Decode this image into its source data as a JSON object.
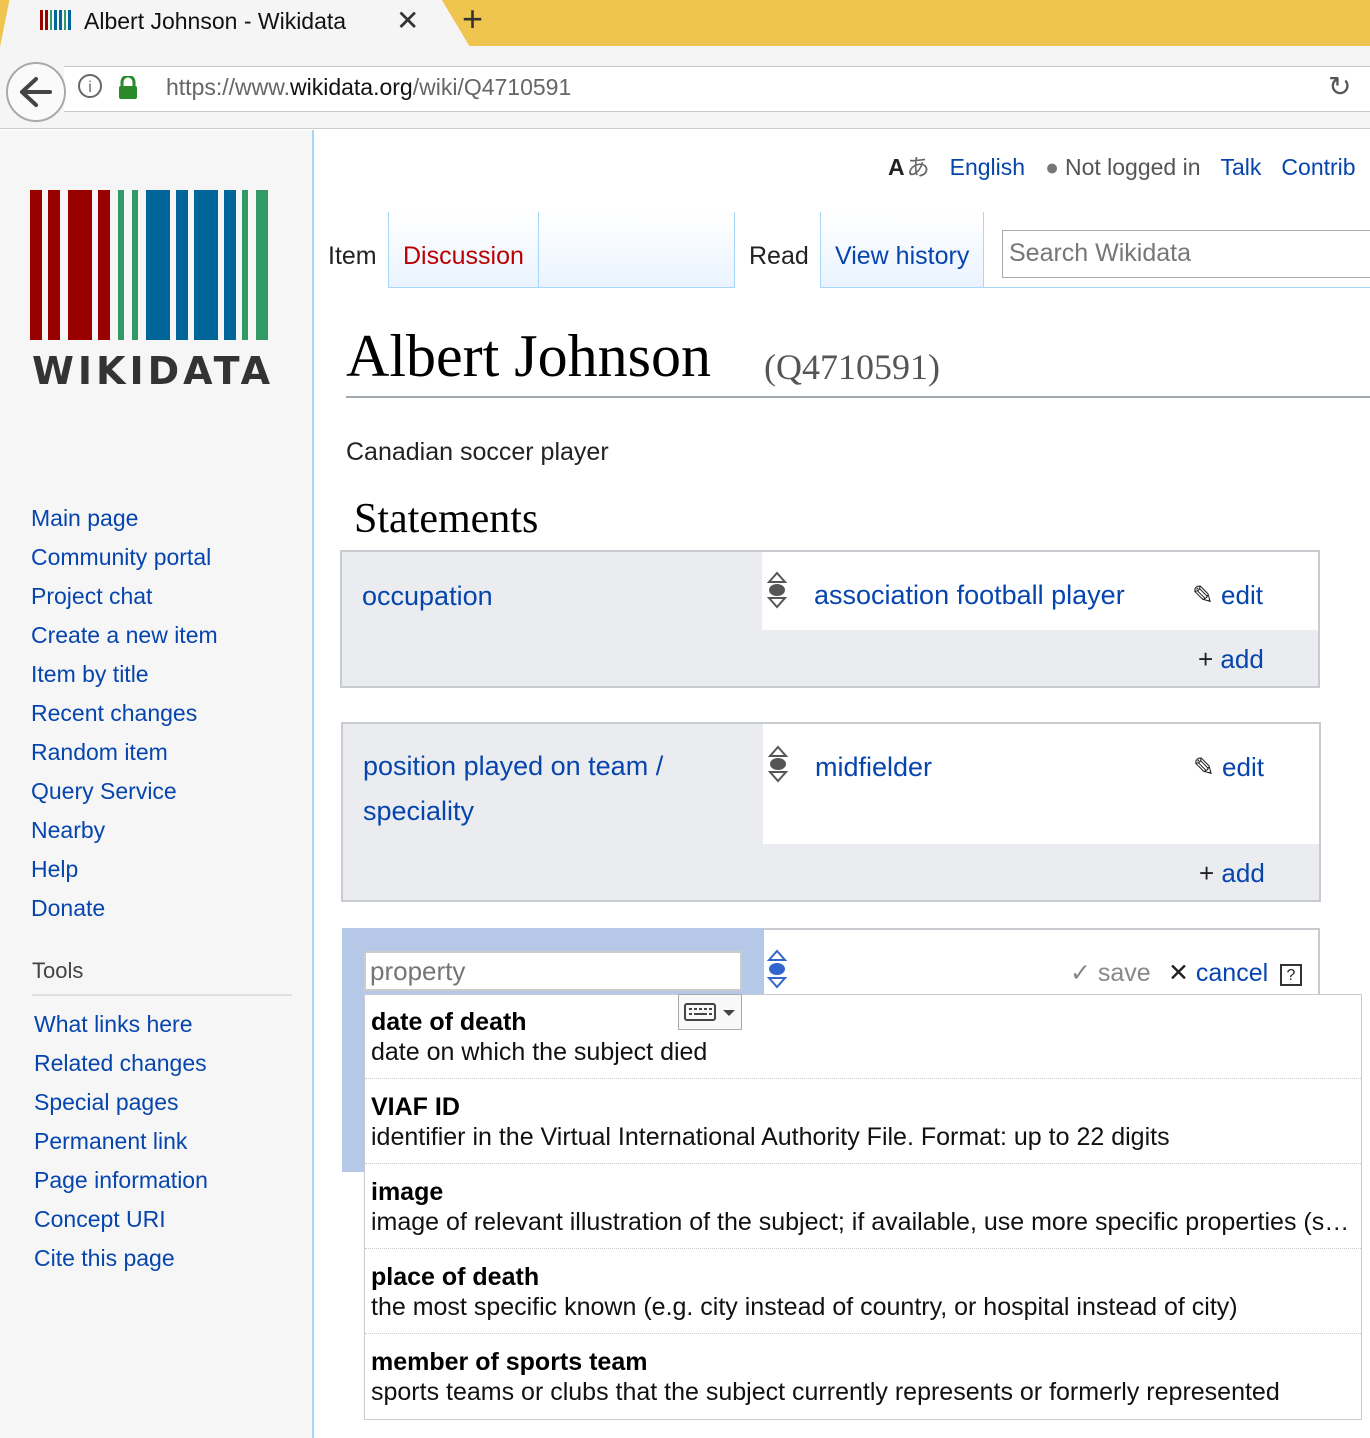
{
  "browser": {
    "tab_title": "Albert Johnson - Wikidata",
    "url_scheme": "https://www.",
    "url_host": "wikidata.org",
    "url_path": "/wiki/Q4710591"
  },
  "personal": {
    "language": "English",
    "not_logged_in": "Not logged in",
    "talk": "Talk",
    "contrib": "Contrib"
  },
  "tabs": {
    "item": "Item",
    "discussion": "Discussion",
    "read": "Read",
    "view_history": "View history"
  },
  "search": {
    "placeholder": "Search Wikidata"
  },
  "logo_text": "WIKIDATA",
  "sidebar": {
    "nav": [
      "Main page",
      "Community portal",
      "Project chat",
      "Create a new item",
      "Item by title",
      "Recent changes",
      "Random item",
      "Query Service",
      "Nearby",
      "Help",
      "Donate"
    ],
    "tools_heading": "Tools",
    "tools": [
      "What links here",
      "Related changes",
      "Special pages",
      "Permanent link",
      "Page information",
      "Concept URI",
      "Cite this page"
    ]
  },
  "page": {
    "title": "Albert Johnson",
    "qid": "(Q4710591)",
    "description": "Canadian soccer player",
    "statements_heading": "Statements"
  },
  "statements": [
    {
      "property": "occupation",
      "value": "association football player",
      "edit": "edit",
      "add": "add"
    },
    {
      "property_line1": "position played on team /",
      "property_line2": "speciality",
      "value": "midfielder",
      "edit": "edit",
      "add": "add"
    }
  ],
  "new_statement": {
    "placeholder": "property",
    "save": "save",
    "cancel": "cancel",
    "help": "?"
  },
  "suggestions": [
    {
      "title": "date of death",
      "desc": "date on which the subject died"
    },
    {
      "title": "VIAF ID",
      "desc": "identifier in the Virtual International Authority File. Format: up to 22 digits"
    },
    {
      "title": "image",
      "desc": "image of relevant illustration of the subject; if available, use more specific properties (sample: coat of arms image, locator map, flag image, signature image, logo image, collage image)"
    },
    {
      "title": "place of death",
      "desc": "the most specific known (e.g. city instead of country, or hospital instead of city)"
    },
    {
      "title": "member of sports team",
      "desc": "sports teams or clubs that the subject currently represents or formerly represented"
    }
  ],
  "colors": {
    "link": "#0645ad",
    "discussion": "#ba0000",
    "tab_border": "#a7d7f9"
  }
}
